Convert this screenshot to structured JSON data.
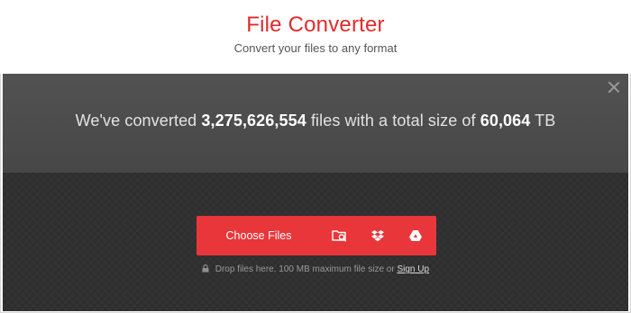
{
  "header": {
    "title": "File Converter",
    "subtitle": "Convert your files to any format"
  },
  "stats": {
    "prefix": "We've converted",
    "files_count": "3,275,626,554",
    "middle": "files with a total size of",
    "total_size": "60,064",
    "unit": "TB"
  },
  "upload": {
    "choose_label": "Choose Files",
    "icons": [
      "folder-search-icon",
      "dropbox-icon",
      "google-drive-icon"
    ]
  },
  "note": {
    "text": "Drop files here. 100 MB maximum file size or",
    "signup_label": "Sign Up"
  },
  "colors": {
    "brand": "#e02b2b",
    "button": "#e8363a",
    "dark_bg": "#333333",
    "stats_band": "#4d4d4d"
  }
}
